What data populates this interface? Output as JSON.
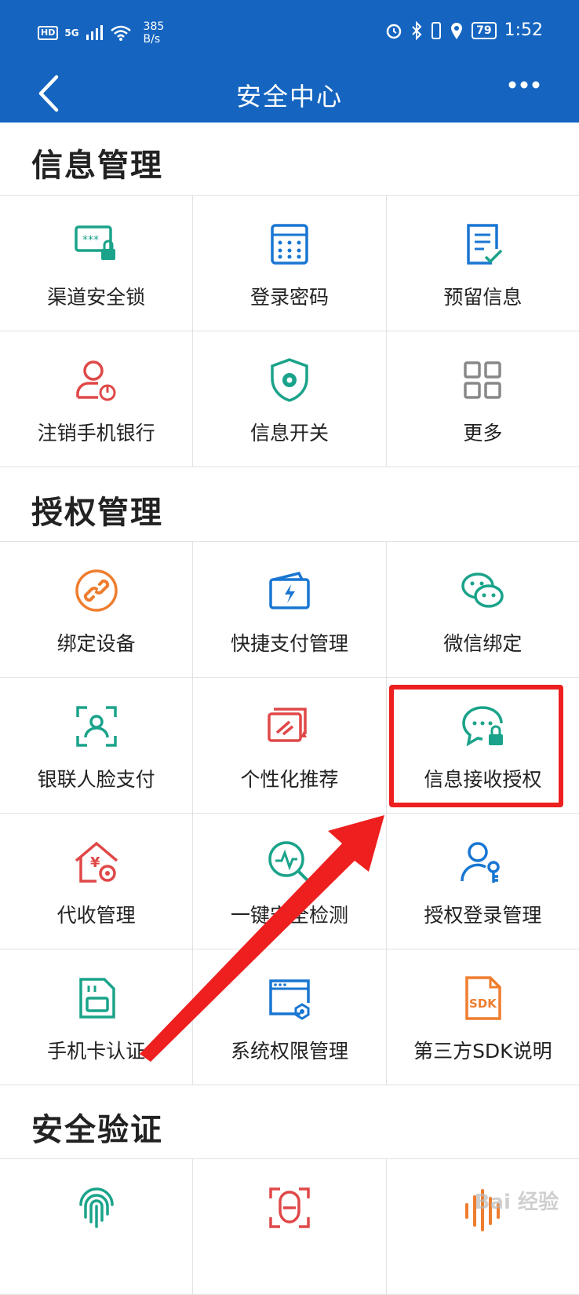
{
  "status_bar": {
    "hd": "HD",
    "network": "5G",
    "speed_value": "385",
    "speed_unit": "B/s",
    "battery": "79",
    "time": "1:52"
  },
  "header": {
    "title": "安全中心"
  },
  "sections": [
    {
      "title": "信息管理",
      "items": [
        {
          "label": "渠道安全锁",
          "icon": "monitor-lock-icon",
          "color": "#1aa38a"
        },
        {
          "label": "登录密码",
          "icon": "keypad-icon",
          "color": "#1976d2"
        },
        {
          "label": "预留信息",
          "icon": "document-check-icon",
          "color": "#1976d2"
        },
        {
          "label": "注销手机银行",
          "icon": "user-power-icon",
          "color": "#e04848"
        },
        {
          "label": "信息开关",
          "icon": "shield-gear-icon",
          "color": "#1aa38a"
        },
        {
          "label": "更多",
          "icon": "grid-more-icon",
          "color": "#888888"
        }
      ]
    },
    {
      "title": "授权管理",
      "items": [
        {
          "label": "绑定设备",
          "icon": "link-icon",
          "color": "#ef7d2e"
        },
        {
          "label": "快捷支付管理",
          "icon": "wallet-bolt-icon",
          "color": "#1976d2"
        },
        {
          "label": "微信绑定",
          "icon": "wechat-icon",
          "color": "#1aa38a"
        },
        {
          "label": "银联人脸支付",
          "icon": "face-scan-icon",
          "color": "#1aa38a"
        },
        {
          "label": "个性化推荐",
          "icon": "cards-pen-icon",
          "color": "#e04848"
        },
        {
          "label": "信息接收授权",
          "icon": "chat-lock-icon",
          "color": "#1aa38a"
        },
        {
          "label": "代收管理",
          "icon": "house-yen-icon",
          "color": "#e04848"
        },
        {
          "label": "一键安全检测",
          "icon": "magnifier-pulse-icon",
          "color": "#1aa38a"
        },
        {
          "label": "授权登录管理",
          "icon": "user-key-icon",
          "color": "#1976d2"
        },
        {
          "label": "手机卡认证",
          "icon": "sim-card-icon",
          "color": "#1aa38a"
        },
        {
          "label": "系统权限管理",
          "icon": "window-gear-icon",
          "color": "#1976d2"
        },
        {
          "label": "第三方SDK说明",
          "icon": "sdk-file-icon",
          "color": "#ef7d2e"
        }
      ]
    },
    {
      "title": "安全验证",
      "items": [
        {
          "label": "",
          "icon": "fingerprint-icon",
          "color": "#1aa38a"
        },
        {
          "label": "",
          "icon": "face-id-icon",
          "color": "#e04848"
        },
        {
          "label": "",
          "icon": "voiceprint-icon",
          "color": "#ef7d2e"
        }
      ]
    }
  ],
  "watermark": "Bai 经验"
}
